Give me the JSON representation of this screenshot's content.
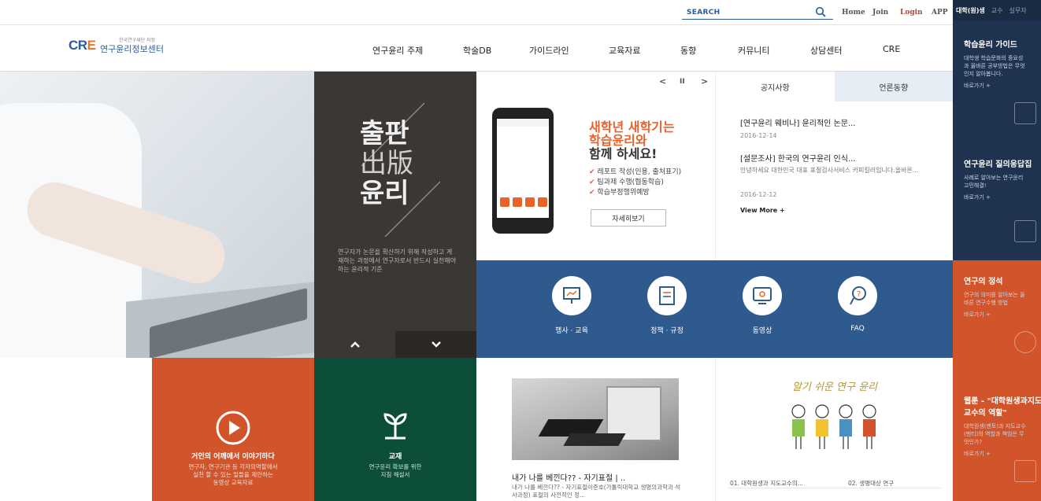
{
  "topbar": {
    "search_label": "SEARCH",
    "links": [
      "Home",
      "Join",
      "Login",
      "APP"
    ]
  },
  "logo": {
    "mark_cr": "CR",
    "mark_e": "E",
    "sub": "한국연구재단 지정",
    "name": "연구윤리정보센터"
  },
  "nav": [
    "연구윤리 주제",
    "학술DB",
    "가이드라인",
    "교육자료",
    "동향",
    "커뮤니티",
    "상담센터",
    "CRE"
  ],
  "right_panel": {
    "tabs": [
      "대학(원)생",
      "교수",
      "실무자"
    ],
    "blocks": [
      {
        "title": "학습윤리 가이드",
        "desc": [
          "대학생 학습문화의 중요성",
          "과 올바른 공부방법은 무엇",
          "인지 알아봅니다."
        ],
        "go": "바로가기 +"
      },
      {
        "title": "연구윤리 질의응답집",
        "desc": [
          "사례로 알아보는 연구윤리",
          "고민해결!"
        ],
        "go": "바로가기 +"
      },
      {
        "title": "연구의 정석",
        "desc": [
          "연구의 의미를 알아보는 올",
          "바른 연구수행 방법"
        ],
        "go": "바로가기 +"
      },
      {
        "title": "웹툰 - \"대학원생과지도",
        "title2": "교수의 역할\"",
        "desc": [
          "대학원생(멘토)과 지도교수",
          "(멘티)의 역할과 책임은 무",
          "엇인가?"
        ],
        "go": "바로가기 +"
      }
    ]
  },
  "publication": {
    "line1": "출판",
    "line2": "出版",
    "line3": "윤리",
    "desc": "연구자가 논문을 확산하기 위해 작성하고 게재하는 과정에서 연구자로서 반드시 실천해야하는 윤리적 기준"
  },
  "banner": {
    "title_line1": "새학년 새학기는",
    "title_line2": "학습윤리와",
    "title_line3": "함께 하세요!",
    "bullets": [
      "레포트 작성(인용, 출처표기)",
      "팀과제 수행(협동학습)",
      "학습부정행위예방"
    ],
    "button": "자세히보기",
    "prev": "<",
    "pause": "II",
    "next": ">"
  },
  "notice": {
    "tabs": [
      "공지사항",
      "언론동향"
    ],
    "items": [
      {
        "title": "[연구윤리 웨비나] 윤리적인 논문...",
        "date": "2016-12-14"
      },
      {
        "title": "[설문조사] 한국의 연구윤리 인식...",
        "excerpt": "안녕하세요 대한민국 대표 표절검사서비스 카피킬러입니다.올바른...",
        "date": "2016-12-12"
      }
    ],
    "more": "View More +"
  },
  "quick_menu": [
    "행사 · 교육",
    "정책 · 규정",
    "동영상",
    "FAQ"
  ],
  "cards": {
    "orange": {
      "title": "거인의 어깨에서 이야기하다",
      "desc": [
        "연구자, 연구기관 등 각자의역할에서",
        "실천 할 수 있는 일들을 제안하는",
        "동영상 교육자료"
      ]
    },
    "green": {
      "title": "교재",
      "desc": [
        "연구윤리 확보를 위한",
        "지침 해설서"
      ]
    }
  },
  "news": {
    "title": "내가 나를 베낀다?? - 자기표절 | ..",
    "desc": "내가 나를 베낀다?? - 자기표절이준호(가톨릭대학교 생명의과학과 석사과정) 표절의 사전적인 정..."
  },
  "ethic": {
    "script": "알기 쉬운 연구 윤리",
    "list": [
      "01. 대학원생과 지도교수의...",
      "02. 생명대상 연구"
    ]
  },
  "colors": {
    "orange": "#d2542a",
    "green": "#0d4e3b",
    "blue": "#2e5a8d",
    "navy": "#1f3350"
  }
}
